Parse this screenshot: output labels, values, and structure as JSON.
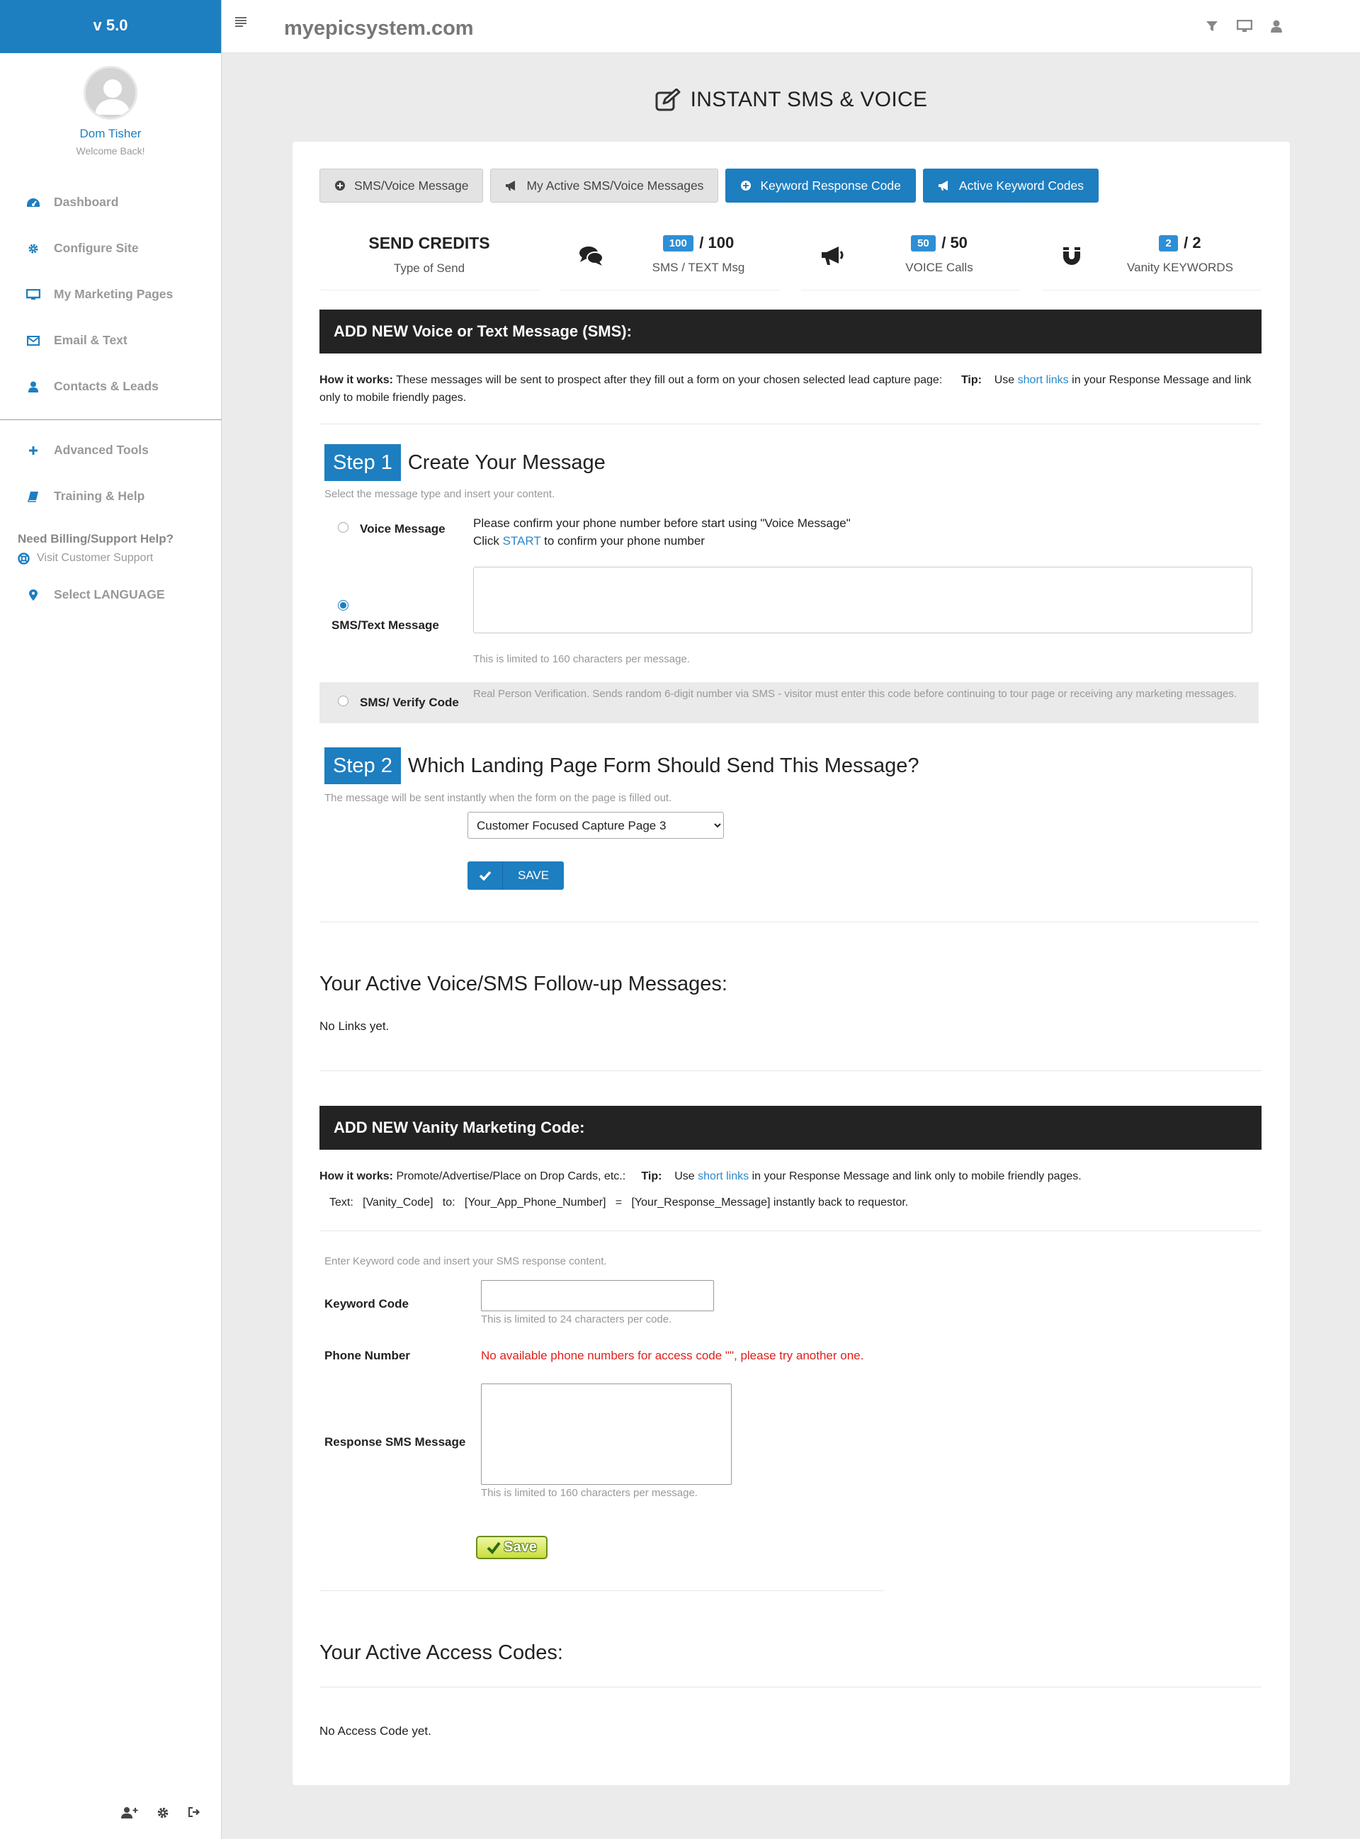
{
  "sidebar": {
    "version": "v 5.0",
    "user_name": "Dom Tisher",
    "welcome": "Welcome Back!",
    "nav_main": [
      {
        "label": "Dashboard",
        "icon": "dashboard-icon"
      },
      {
        "label": "Configure Site",
        "icon": "gear-icon"
      },
      {
        "label": "My Marketing Pages",
        "icon": "monitor-icon"
      },
      {
        "label": "Email & Text",
        "icon": "envelope-icon"
      },
      {
        "label": "Contacts & Leads",
        "icon": "user-icon"
      }
    ],
    "nav_secondary": [
      {
        "label": "Advanced Tools",
        "icon": "plus-icon"
      },
      {
        "label": "Training & Help",
        "icon": "book-icon"
      }
    ],
    "billing_title": "Need Billing/Support Help?",
    "support_link": "Visit Customer Support",
    "language": "Select LANGUAGE",
    "accent_color": "#1d7ec0"
  },
  "topbar": {
    "site_title": "myepicsystem.com"
  },
  "page": {
    "title": "INSTANT SMS & VOICE"
  },
  "tabs": [
    {
      "label": "SMS/Voice Message",
      "active": false
    },
    {
      "label": "My Active SMS/Voice Messages",
      "active": false
    },
    {
      "label": "Keyword Response Code",
      "active": true
    },
    {
      "label": "Active Keyword Codes",
      "active": true
    }
  ],
  "credits": {
    "heading": "SEND CREDITS",
    "heading_sub": "Type of Send",
    "items": [
      {
        "badge": "100",
        "total": "/ 100",
        "label": "SMS / TEXT Msg",
        "icon": "comments-icon"
      },
      {
        "badge": "50",
        "total": "/ 50",
        "label": "VOICE Calls",
        "icon": "megaphone-icon"
      },
      {
        "badge": "2",
        "total": "/ 2",
        "label": "Vanity KEYWORDS",
        "icon": "magnet-icon"
      }
    ]
  },
  "sms_section": {
    "bar_title": "ADD NEW Voice or Text Message (SMS):",
    "how_label": "How it works:",
    "how_text": " These messages will be sent to prospect after they fill out a form on your chosen selected lead capture page:",
    "tip_label": "Tip:",
    "tip_pre": "Use ",
    "tip_link": "short links",
    "tip_post": " in your Response Message and link only to mobile friendly pages.",
    "step1_num": "Step 1",
    "step1_title": "Create Your Message",
    "step1_hint": "Select the message type and insert your content.",
    "voice_label": "Voice Message",
    "voice_note_1": "Please confirm your phone number before start using \"Voice Message\"",
    "voice_note_2_pre": "Click ",
    "voice_note_2_link": "START",
    "voice_note_2_post": " to confirm your phone number",
    "sms_label": "SMS/Text Message",
    "sms_limit": "This is limited to 160 characters per message.",
    "verify_label": "SMS/ Verify Code",
    "verify_desc": "Real Person Verification. Sends random 6-digit number via SMS - visitor must enter this code before continuing to tour page or receiving any marketing messages.",
    "step2_num": "Step 2",
    "step2_title": "Which Landing Page Form Should Send This Message?",
    "step2_hint": "The message will be sent instantly when the form on the page is filled out.",
    "selected_page": "Customer Focused Capture Page 3",
    "save_label": "SAVE"
  },
  "active_messages": {
    "heading": "Your Active Voice/SMS Follow-up Messages:",
    "empty": "No Links yet."
  },
  "vanity_section": {
    "bar_title": "ADD NEW Vanity Marketing Code:",
    "how_label": "How it works:",
    "how_text": " Promote/Advertise/Place on Drop Cards, etc.:",
    "tip_label": "Tip:",
    "tip_pre": "Use ",
    "tip_link": "short links",
    "tip_post": " in your Response Message and link only to mobile friendly pages.",
    "formula": "Text:   [Vanity_Code]   to:   [Your_App_Phone_Number]   =   [Your_Response_Message] instantly back to requestor.",
    "hint": "Enter Keyword code and insert your SMS response content.",
    "keyword_label": "Keyword Code",
    "keyword_value": "",
    "keyword_limit": "This is limited to 24 characters per code.",
    "phone_label": "Phone Number",
    "phone_error": "No available phone numbers for access code \"\", please try another one.",
    "response_label": "Response SMS Message",
    "response_limit": "This is limited to 160 characters per message.",
    "save_label": "Save"
  },
  "active_codes": {
    "heading": "Your Active Access Codes:",
    "empty": "No Access Code yet."
  }
}
